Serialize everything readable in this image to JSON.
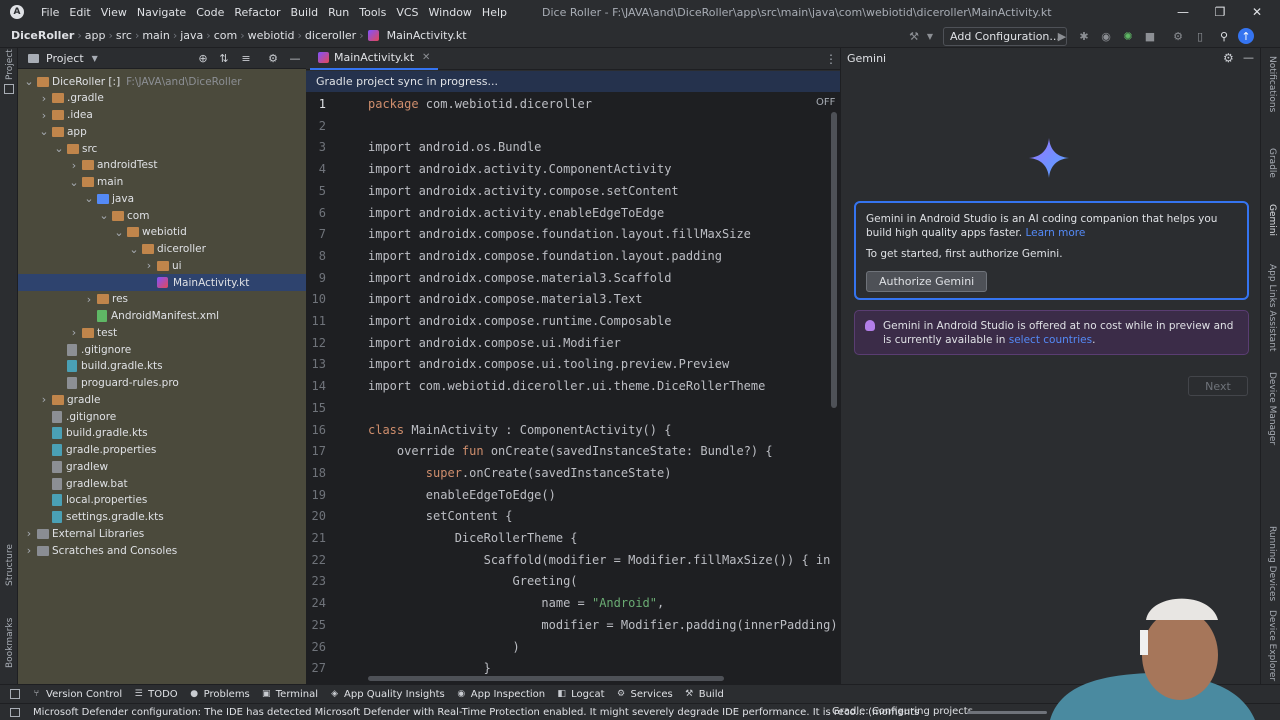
{
  "menu": [
    "File",
    "Edit",
    "View",
    "Navigate",
    "Code",
    "Refactor",
    "Build",
    "Run",
    "Tools",
    "VCS",
    "Window",
    "Help"
  ],
  "window_title": "Dice Roller - F:\\JAVA\\and\\DiceRoller\\app\\src\\main\\java\\com\\webiotid\\diceroller\\MainActivity.kt",
  "breadcrumbs": [
    "DiceRoller",
    "app",
    "src",
    "main",
    "java",
    "com",
    "webiotid",
    "diceroller",
    "MainActivity.kt"
  ],
  "run_config_label": "Add Configuration...",
  "project_panel": {
    "title": "Project",
    "tree": [
      {
        "label": "DiceRoller [:]",
        "path": "F:\\JAVA\\and\\DiceRoller",
        "depth": 0,
        "type": "module",
        "expanded": true
      },
      {
        "label": ".gradle",
        "depth": 1,
        "type": "folder",
        "expanded": false
      },
      {
        "label": ".idea",
        "depth": 1,
        "type": "folder",
        "expanded": false
      },
      {
        "label": "app",
        "depth": 1,
        "type": "folder",
        "expanded": true
      },
      {
        "label": "src",
        "depth": 2,
        "type": "folder",
        "expanded": true
      },
      {
        "label": "androidTest",
        "depth": 3,
        "type": "folder",
        "expanded": false
      },
      {
        "label": "main",
        "depth": 3,
        "type": "folder",
        "expanded": true
      },
      {
        "label": "java",
        "depth": 4,
        "type": "folder-blue",
        "expanded": true
      },
      {
        "label": "com",
        "depth": 5,
        "type": "folder",
        "expanded": true
      },
      {
        "label": "webiotid",
        "depth": 6,
        "type": "folder",
        "expanded": true
      },
      {
        "label": "diceroller",
        "depth": 7,
        "type": "folder",
        "expanded": true
      },
      {
        "label": "ui",
        "depth": 8,
        "type": "folder",
        "expanded": false
      },
      {
        "label": "MainActivity.kt",
        "depth": 8,
        "type": "kotlin",
        "selected": true
      },
      {
        "label": "res",
        "depth": 4,
        "type": "folder",
        "expanded": false
      },
      {
        "label": "AndroidManifest.xml",
        "depth": 4,
        "type": "manifest"
      },
      {
        "label": "test",
        "depth": 3,
        "type": "folder",
        "expanded": false
      },
      {
        "label": ".gitignore",
        "depth": 2,
        "type": "file"
      },
      {
        "label": "build.gradle.kts",
        "depth": 2,
        "type": "gradle"
      },
      {
        "label": "proguard-rules.pro",
        "depth": 2,
        "type": "file"
      },
      {
        "label": "gradle",
        "depth": 1,
        "type": "folder",
        "expanded": false
      },
      {
        "label": ".gitignore",
        "depth": 1,
        "type": "file"
      },
      {
        "label": "build.gradle.kts",
        "depth": 1,
        "type": "gradle"
      },
      {
        "label": "gradle.properties",
        "depth": 1,
        "type": "gradle"
      },
      {
        "label": "gradlew",
        "depth": 1,
        "type": "file"
      },
      {
        "label": "gradlew.bat",
        "depth": 1,
        "type": "file"
      },
      {
        "label": "local.properties",
        "depth": 1,
        "type": "gradle"
      },
      {
        "label": "settings.gradle.kts",
        "depth": 1,
        "type": "gradle"
      },
      {
        "label": "External Libraries",
        "depth": 0,
        "type": "library",
        "expanded": false
      },
      {
        "label": "Scratches and Consoles",
        "depth": 0,
        "type": "scratch",
        "expanded": false
      }
    ]
  },
  "editor": {
    "tab_label": "MainActivity.kt",
    "sync_banner": "Gradle project sync in progress...",
    "inlay_label": "OFF",
    "current_line": 1,
    "lines": [
      [
        {
          "t": "kw",
          "s": "package"
        },
        {
          "t": "p",
          "s": " com.webiotid.diceroller"
        }
      ],
      [],
      [
        {
          "t": "p",
          "s": "import android.os.Bundle"
        }
      ],
      [
        {
          "t": "p",
          "s": "import androidx.activity.ComponentActivity"
        }
      ],
      [
        {
          "t": "p",
          "s": "import androidx.activity.compose.setContent"
        }
      ],
      [
        {
          "t": "p",
          "s": "import androidx.activity.enableEdgeToEdge"
        }
      ],
      [
        {
          "t": "p",
          "s": "import androidx.compose.foundation.layout.fillMaxSize"
        }
      ],
      [
        {
          "t": "p",
          "s": "import androidx.compose.foundation.layout.padding"
        }
      ],
      [
        {
          "t": "p",
          "s": "import androidx.compose.material3.Scaffold"
        }
      ],
      [
        {
          "t": "p",
          "s": "import androidx.compose.material3.Text"
        }
      ],
      [
        {
          "t": "p",
          "s": "import androidx.compose.runtime.Composable"
        }
      ],
      [
        {
          "t": "p",
          "s": "import androidx.compose.ui.Modifier"
        }
      ],
      [
        {
          "t": "p",
          "s": "import androidx.compose.ui.tooling.preview.Preview"
        }
      ],
      [
        {
          "t": "p",
          "s": "import com.webiotid.diceroller.ui.theme.DiceRollerTheme"
        }
      ],
      [],
      [
        {
          "t": "kw",
          "s": "class"
        },
        {
          "t": "p",
          "s": " MainActivity : ComponentActivity() {"
        }
      ],
      [
        {
          "t": "p",
          "s": "    override "
        },
        {
          "t": "kw",
          "s": "fun"
        },
        {
          "t": "p",
          "s": " onCreate(savedInstanceState: Bundle?) {"
        }
      ],
      [
        {
          "t": "p",
          "s": "        "
        },
        {
          "t": "kw",
          "s": "super"
        },
        {
          "t": "p",
          "s": ".onCreate(savedInstanceState)"
        }
      ],
      [
        {
          "t": "p",
          "s": "        enableEdgeToEdge()"
        }
      ],
      [
        {
          "t": "p",
          "s": "        setContent {"
        }
      ],
      [
        {
          "t": "p",
          "s": "            DiceRollerTheme {"
        }
      ],
      [
        {
          "t": "p",
          "s": "                Scaffold(modifier = Modifier.fillMaxSize()) { in"
        }
      ],
      [
        {
          "t": "p",
          "s": "                    Greeting("
        }
      ],
      [
        {
          "t": "p",
          "s": "                        name = "
        },
        {
          "t": "str",
          "s": "\"Android\""
        },
        {
          "t": "p",
          "s": ","
        }
      ],
      [
        {
          "t": "p",
          "s": "                        modifier = Modifier.padding(innerPadding)"
        }
      ],
      [
        {
          "t": "p",
          "s": "                    )"
        }
      ],
      [
        {
          "t": "p",
          "s": "                }"
        }
      ]
    ]
  },
  "gemini": {
    "title": "Gemini",
    "card_text": "Gemini in Android Studio is an AI coding companion that helps you build high quality apps faster.",
    "learn_more": "Learn more",
    "card_text2": "To get started, first authorize Gemini.",
    "authorize_label": "Authorize Gemini",
    "notice_text": "Gemini in Android Studio is offered at no cost while in preview and is currently available in",
    "notice_link": "select countries",
    "notice_end": ".",
    "next_label": "Next"
  },
  "left_strip": [
    "Project",
    "Structure",
    "Bookmarks"
  ],
  "right_strip": [
    "Notifications",
    "Gradle",
    "Gemini",
    "App Links Assistant",
    "Device Manager",
    "Running Devices",
    "Device Explorer"
  ],
  "tool_tabs": [
    {
      "label": "Version Control",
      "icon": "branch-icon"
    },
    {
      "label": "TODO",
      "icon": "list-icon"
    },
    {
      "label": "Problems",
      "icon": "warning-icon"
    },
    {
      "label": "Terminal",
      "icon": "terminal-icon"
    },
    {
      "label": "App Quality Insights",
      "icon": "insights-icon"
    },
    {
      "label": "App Inspection",
      "icon": "inspect-icon"
    },
    {
      "label": "Logcat",
      "icon": "logcat-icon"
    },
    {
      "label": "Services",
      "icon": "services-icon"
    },
    {
      "label": "Build",
      "icon": "hammer-icon"
    }
  ],
  "status": {
    "message": "Microsoft Defender configuration: The IDE has detected Microsoft Defender with Real-Time Protection enabled. It might severely degrade IDE performance. It is reco... (moments",
    "gradle": "Gradle: Configuring projects..."
  },
  "colors": {
    "accent": "#3574f0",
    "keyword": "#cf8e6d",
    "string": "#6aab73",
    "selection": "#2e436e",
    "project_bg": "#4b4a3c"
  }
}
